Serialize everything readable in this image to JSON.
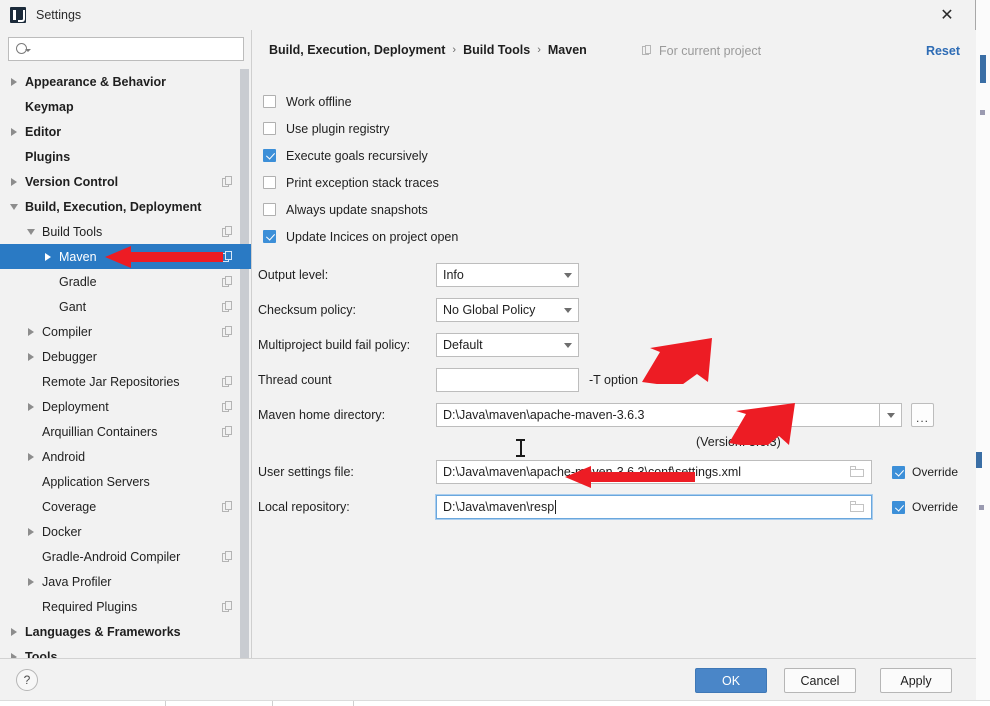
{
  "window": {
    "title": "Settings",
    "app_icon": "intellij-idea-icon",
    "close_label": "✕"
  },
  "search": {
    "value": "",
    "placeholder": ""
  },
  "sidebar": {
    "items": [
      {
        "label": "Appearance & Behavior",
        "indent": 0,
        "expander": "collapsed",
        "bold": true,
        "copy": false,
        "selected": false
      },
      {
        "label": "Keymap",
        "indent": 0,
        "expander": "none",
        "bold": true,
        "copy": false,
        "selected": false
      },
      {
        "label": "Editor",
        "indent": 0,
        "expander": "collapsed",
        "bold": true,
        "copy": false,
        "selected": false
      },
      {
        "label": "Plugins",
        "indent": 0,
        "expander": "none",
        "bold": true,
        "copy": false,
        "selected": false
      },
      {
        "label": "Version Control",
        "indent": 0,
        "expander": "collapsed",
        "bold": true,
        "copy": true,
        "selected": false
      },
      {
        "label": "Build, Execution, Deployment",
        "indent": 0,
        "expander": "expanded",
        "bold": true,
        "copy": false,
        "selected": false
      },
      {
        "label": "Build Tools",
        "indent": 1,
        "expander": "expanded",
        "bold": false,
        "copy": true,
        "selected": false
      },
      {
        "label": "Maven",
        "indent": 2,
        "expander": "collapsed",
        "bold": false,
        "copy": true,
        "selected": true
      },
      {
        "label": "Gradle",
        "indent": 2,
        "expander": "none",
        "bold": false,
        "copy": true,
        "selected": false
      },
      {
        "label": "Gant",
        "indent": 2,
        "expander": "none",
        "bold": false,
        "copy": true,
        "selected": false
      },
      {
        "label": "Compiler",
        "indent": 1,
        "expander": "collapsed",
        "bold": false,
        "copy": true,
        "selected": false
      },
      {
        "label": "Debugger",
        "indent": 1,
        "expander": "collapsed",
        "bold": false,
        "copy": false,
        "selected": false
      },
      {
        "label": "Remote Jar Repositories",
        "indent": 1,
        "expander": "none",
        "bold": false,
        "copy": true,
        "selected": false
      },
      {
        "label": "Deployment",
        "indent": 1,
        "expander": "collapsed",
        "bold": false,
        "copy": true,
        "selected": false
      },
      {
        "label": "Arquillian Containers",
        "indent": 1,
        "expander": "none",
        "bold": false,
        "copy": true,
        "selected": false
      },
      {
        "label": "Android",
        "indent": 1,
        "expander": "collapsed",
        "bold": false,
        "copy": false,
        "selected": false
      },
      {
        "label": "Application Servers",
        "indent": 1,
        "expander": "none",
        "bold": false,
        "copy": false,
        "selected": false
      },
      {
        "label": "Coverage",
        "indent": 1,
        "expander": "none",
        "bold": false,
        "copy": true,
        "selected": false
      },
      {
        "label": "Docker",
        "indent": 1,
        "expander": "collapsed",
        "bold": false,
        "copy": false,
        "selected": false
      },
      {
        "label": "Gradle-Android Compiler",
        "indent": 1,
        "expander": "none",
        "bold": false,
        "copy": true,
        "selected": false
      },
      {
        "label": "Java Profiler",
        "indent": 1,
        "expander": "collapsed",
        "bold": false,
        "copy": false,
        "selected": false
      },
      {
        "label": "Required Plugins",
        "indent": 1,
        "expander": "none",
        "bold": false,
        "copy": true,
        "selected": false
      },
      {
        "label": "Languages & Frameworks",
        "indent": 0,
        "expander": "collapsed",
        "bold": true,
        "copy": false,
        "selected": false
      },
      {
        "label": "Tools",
        "indent": 0,
        "expander": "collapsed",
        "bold": true,
        "copy": false,
        "selected": false
      }
    ]
  },
  "header": {
    "breadcrumb": [
      "Build, Execution, Deployment",
      "Build Tools",
      "Maven"
    ],
    "separator": "›",
    "scope_label": "For current project",
    "scope_icon": "project-scope-icon",
    "reset_label": "Reset"
  },
  "checkboxes": [
    {
      "label": "Work offline",
      "checked": false
    },
    {
      "label": "Use plugin registry",
      "checked": false
    },
    {
      "label": "Execute goals recursively",
      "checked": true
    },
    {
      "label": "Print exception stack traces",
      "checked": false
    },
    {
      "label": "Always update snapshots",
      "checked": false
    },
    {
      "label": "Update Incices on project open",
      "checked": true
    }
  ],
  "fields": {
    "output_level": {
      "label": "Output level:",
      "value": "Info"
    },
    "checksum_policy": {
      "label": "Checksum policy:",
      "value": "No Global Policy"
    },
    "multiproject_fail_policy": {
      "label": "Multiproject build fail policy:",
      "value": "Default"
    },
    "thread_count": {
      "label": "Thread count",
      "value": "",
      "hint": "-T option"
    },
    "maven_home": {
      "label": "Maven home directory:",
      "value": "D:\\Java\\maven\\apache-maven-3.6.3",
      "dots_label": "...",
      "version_note": "(Version: 3.6.3)"
    },
    "user_settings": {
      "label": "User settings file:",
      "value": "D:\\Java\\maven\\apache-maven-3.6.3\\conf\\settings.xml",
      "override_label": "Override",
      "override_checked": true
    },
    "local_repository": {
      "label": "Local repository:",
      "value": "D:\\Java\\maven\\resp",
      "override_label": "Override",
      "override_checked": true,
      "focused": true
    }
  },
  "footer": {
    "help_label": "?",
    "ok_label": "OK",
    "cancel_label": "Cancel",
    "apply_label": "Apply"
  },
  "colors": {
    "accent_blue": "#2a7ac4",
    "primary_button": "#4a86c8",
    "checkbox_checked": "#3c8fd8",
    "link_blue": "#2e6cb5",
    "annotation_red": "#ed1c24",
    "panel_bg": "#f2f2f2"
  },
  "annotations": {
    "arrow_color": "#ed1c24",
    "arrows": [
      {
        "name": "arrow-to-maven-tree-item"
      },
      {
        "name": "arrow-to-maven-home-directory"
      },
      {
        "name": "arrow-to-user-settings-file"
      },
      {
        "name": "arrow-to-local-repository"
      }
    ]
  }
}
